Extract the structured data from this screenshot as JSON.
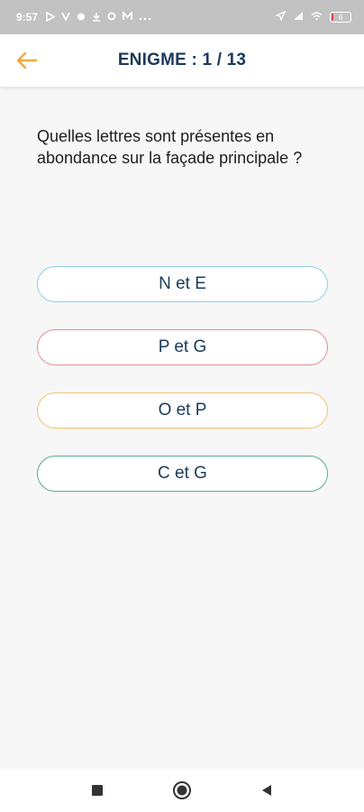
{
  "status_bar": {
    "time": "9:57",
    "left_icons": [
      "play-store-icon",
      "v-icon",
      "notification-icon",
      "download-icon",
      "circle-icon",
      "mail-icon"
    ],
    "battery_level": "6"
  },
  "header": {
    "title": "ENIGME : 1 / 13",
    "back_icon": "back-arrow-icon"
  },
  "question": {
    "text": "Quelles lettres sont présentes en abondance sur la façade principale ?"
  },
  "answers": [
    {
      "label": "N et E",
      "color": "#8ecfe0"
    },
    {
      "label": "P et G",
      "color": "#e58f8f"
    },
    {
      "label": "O et P",
      "color": "#f0c371"
    },
    {
      "label": "C et G",
      "color": "#5aa99a"
    }
  ],
  "colors": {
    "accent_arrow": "#f2a93b",
    "title": "#1b3a5b"
  },
  "nav": {
    "icons": [
      "recents-square-icon",
      "home-circle-icon",
      "back-triangle-icon"
    ]
  }
}
